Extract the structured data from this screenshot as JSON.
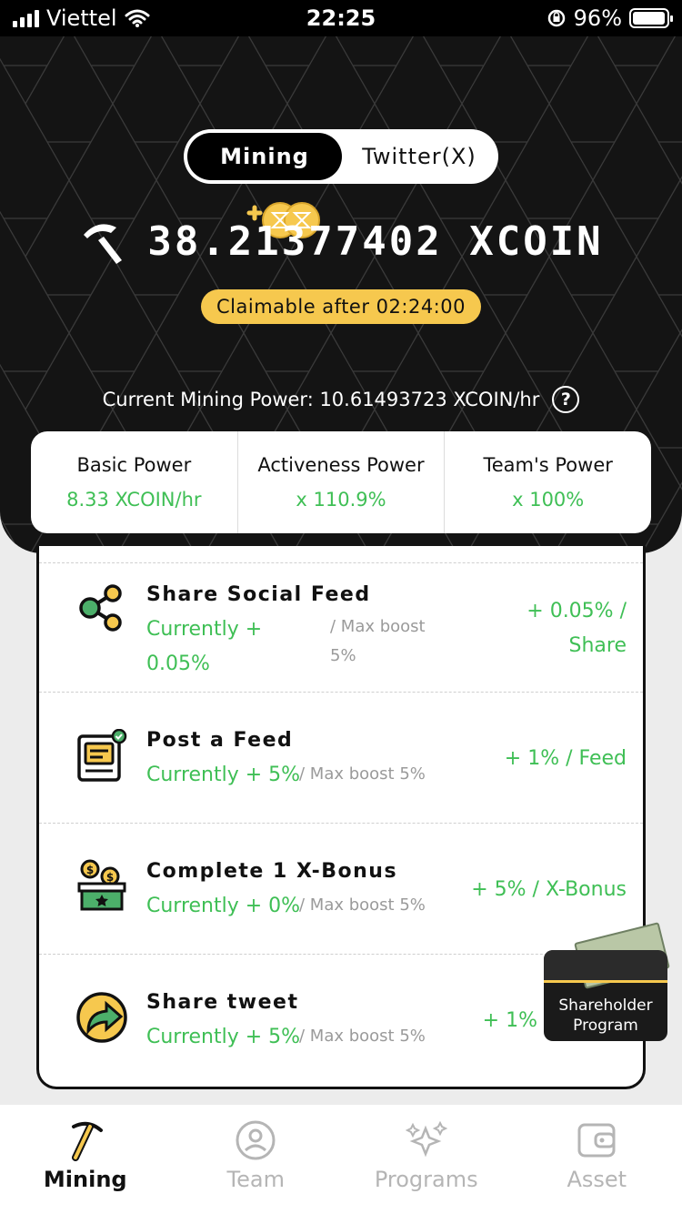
{
  "status_bar": {
    "carrier": "Viettel",
    "time": "22:25",
    "battery": "96%",
    "battery_level": 0.96,
    "icons": [
      "signal-icon",
      "wifi-icon",
      "rotation-lock-icon",
      "battery-icon"
    ]
  },
  "tabs": {
    "items": [
      {
        "label": "Mining",
        "active": true
      },
      {
        "label": "Twitter(X)",
        "active": false
      }
    ]
  },
  "balance": {
    "amount": "38.21377402 XCOIN",
    "icon": "pickaxe-icon",
    "claim_label": "Claimable after 02:24:00"
  },
  "mining_power": {
    "label": "Current Mining Power: 10.61493723 XCOIN/hr",
    "help_icon": "?"
  },
  "power_breakdown": [
    {
      "title": "Basic Power",
      "value": "8.33 XCOIN/hr"
    },
    {
      "title": "Activeness Power",
      "value": "x 110.9%"
    },
    {
      "title": "Team's Power",
      "value": "x 100%"
    }
  ],
  "tasks": [
    {
      "title": "Share Social Feed",
      "current_line1": "Currently +",
      "current_line2": "0.05%",
      "max_line1": "/ Max boost",
      "max_line2": "5%",
      "reward_line1": "+ 0.05% /",
      "reward_line2": "Share",
      "icon": "share-icon"
    },
    {
      "title": "Post a Feed",
      "current": "Currently + 5%",
      "max": "/ Max boost 5%",
      "reward": "+ 1% / Feed",
      "icon": "post-feed-icon"
    },
    {
      "title": "Complete 1 X-Bonus",
      "current": "Currently + 0%",
      "max": "/ Max boost 5%",
      "reward": "+ 5% / X-Bonus",
      "icon": "bonus-box-icon"
    },
    {
      "title": "Share tweet",
      "current": "Currently + 5%",
      "max": "/ Max boost 5%",
      "reward": "+ 1%",
      "icon": "share-tweet-icon"
    }
  ],
  "shareholder": {
    "line1": "Shareholder",
    "line2": "Program",
    "icon": "wallet-money-icon"
  },
  "bottom_nav": [
    {
      "label": "Mining",
      "icon": "pickaxe-icon",
      "active": true
    },
    {
      "label": "Team",
      "icon": "user-icon",
      "active": false
    },
    {
      "label": "Programs",
      "icon": "sparkles-icon",
      "active": false
    },
    {
      "label": "Asset",
      "icon": "wallet-icon",
      "active": false
    }
  ],
  "colors": {
    "accent_green": "#3fbf55",
    "accent_yellow": "#f6c84e",
    "header_bg": "#141414"
  }
}
